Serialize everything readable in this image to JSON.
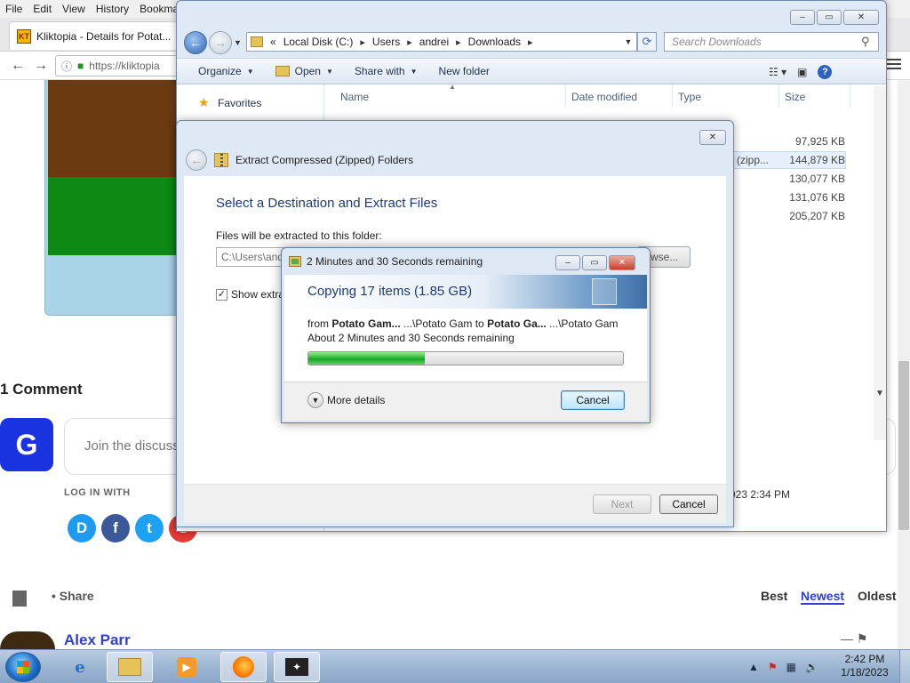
{
  "firefox": {
    "menu": [
      "File",
      "Edit",
      "View",
      "History",
      "Bookma"
    ],
    "tab_title": "Kliktopia - Details for Potat...",
    "tab_favicon": "KT",
    "url": "https://kliktopia"
  },
  "page": {
    "comments_title": "1 Comment",
    "avatar_letter": "G",
    "discuss_placeholder": "Join the discuss",
    "login_with": "LOG IN WITH",
    "social": [
      {
        "label": "D",
        "color": "#1d9bf0"
      },
      {
        "label": "f",
        "color": "#3b5998"
      },
      {
        "label": "t",
        "color": "#1da1f2"
      },
      {
        "label": "G",
        "color": "#e53935"
      }
    ],
    "share": "Share",
    "sort": {
      "best": "Best",
      "newest": "Newest",
      "oldest": "Oldest"
    },
    "commenter": "Alex Parr",
    "comment_icons": "— ⚑"
  },
  "explorer": {
    "breadcrumb": [
      "«",
      "Local Disk (C:)",
      "Users",
      "andrei",
      "Downloads"
    ],
    "search_placeholder": "Search Downloads",
    "toolbar": {
      "organize": "Organize",
      "open": "Open",
      "share_with": "Share with",
      "new_folder": "New folder"
    },
    "favorites": "Favorites",
    "columns": {
      "name": "Name",
      "date": "Date modified",
      "type": "Type",
      "size": "Size"
    },
    "sizes": [
      "97,925 KB",
      "144,879 KB",
      "130,077 KB",
      "131,076 KB",
      "205,207 KB"
    ],
    "selected_type_fragment": "d (zipp...",
    "details_fragment": "023 2:34 PM"
  },
  "extract": {
    "header": "Extract Compressed (Zipped) Folders",
    "title": "Select a Destination and Extract Files",
    "label": "Files will be extracted to this folder:",
    "path": "C:\\Users\\and",
    "browse": "wse...",
    "show_label": "Show extra",
    "next": "Next",
    "cancel": "Cancel"
  },
  "copy": {
    "window_title": "2 Minutes and 30 Seconds remaining",
    "heading": "Copying 17 items (1.85 GB)",
    "from_prefix": "from ",
    "from_name": "Potato Gam...",
    "from_path": " ...\\Potato Gam to ",
    "to_name": "Potato Ga...",
    "to_path": "   ...\\Potato Gam",
    "remaining": "About 2 Minutes and 30 Seconds remaining",
    "progress": 0.37,
    "more_details": "More details",
    "cancel": "Cancel"
  },
  "taskbar": {
    "time": "2:42 PM",
    "date": "1/18/2023"
  }
}
